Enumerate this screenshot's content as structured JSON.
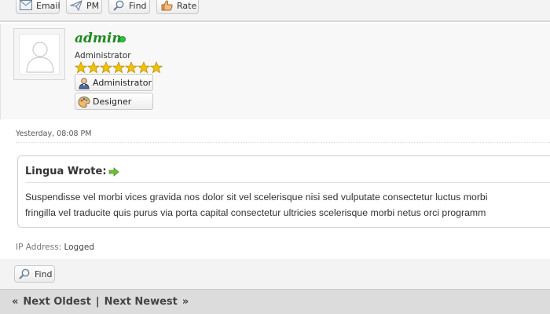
{
  "toolbar": {
    "email_label": "Email",
    "pm_label": "PM",
    "find_label": "Find",
    "rate_label": "Rate"
  },
  "author": {
    "username": "admin",
    "title": "Administrator",
    "stars": 7,
    "groups": [
      "Administrator",
      "Designer"
    ]
  },
  "post": {
    "date": "Yesterday, 08:08 PM",
    "quote_author": "Lingua Wrote:",
    "quote_line1": "Suspendisse vel morbi vices gravida nos dolor sit vel scelerisque nisi sed vulputate consectetur luctus morbi",
    "quote_line2": "fringilla vel traducite quis purus via porta capital consectetur ultricies scelerisque morbi netus orci programm",
    "ip_label": "IP Address:",
    "ip_value": "Logged"
  },
  "actions": {
    "find_label": "Find"
  },
  "nav": {
    "prev_arrow": "«",
    "prev_label": "Next Oldest",
    "separator": "|",
    "next_label": "Next Newest",
    "next_arrow": "»"
  },
  "colors": {
    "username": "#1f8a22",
    "online": "#33c23a",
    "star": "#f2c200"
  }
}
